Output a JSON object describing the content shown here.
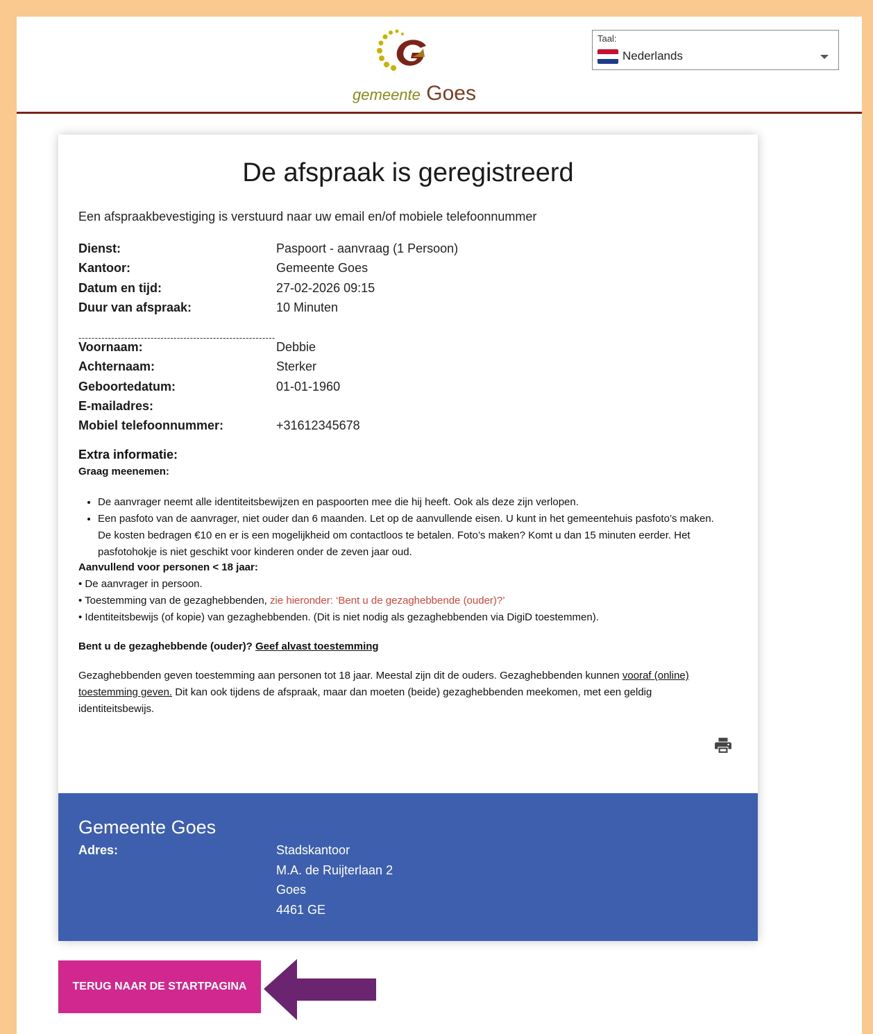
{
  "header": {
    "logo_small": "gemeente",
    "logo_big": "Goes",
    "language": {
      "label": "Taal:",
      "value": "Nederlands"
    }
  },
  "confirmation": {
    "title": "De afspraak is geregistreerd",
    "intro": "Een afspraakbevestiging is verstuurd naar uw email en/of mobiele telefoonnummer",
    "appointment": [
      {
        "label": "Dienst:",
        "value": "Paspoort - aanvraag (1 Persoon)"
      },
      {
        "label": "Kantoor:",
        "value": "Gemeente Goes"
      },
      {
        "label": "Datum en tijd:",
        "value": "27-02-2026 09:15"
      },
      {
        "label": "Duur van afspraak:",
        "value": "10 Minuten"
      }
    ],
    "separator": "------------------------------------------------------------",
    "person": [
      {
        "label": "Voornaam:",
        "value": "Debbie"
      },
      {
        "label": "Achternaam:",
        "value": "Sterker"
      },
      {
        "label": "Geboortedatum:",
        "value": "01-01-1960"
      },
      {
        "label": "E-mailadres:",
        "value": ""
      },
      {
        "label": "Mobiel telefoonnummer:",
        "value": "+31612345678"
      }
    ]
  },
  "extra": {
    "heading": "Extra informatie:",
    "bring_heading": "Graag meenemen:",
    "bullets": [
      "De aanvrager neemt alle identiteitsbewijzen en paspoorten mee die hij heeft. Ook als deze zijn verlopen.",
      "Een pasfoto van de aanvrager, niet ouder dan 6 maanden. Let op de aanvullende eisen. U kunt in het gemeentehuis pasfoto’s maken. De kosten bedragen €10 en er is een mogelijkheid om contactloos te betalen. Foto’s maken? Komt u dan 15 minuten eerder. Het pasfotohokje is niet geschikt voor kinderen onder de zeven jaar oud."
    ],
    "minor_heading": "Aanvullend voor personen < 18 jaar:",
    "minor_1": "• De aanvrager in persoon.",
    "minor_2_prefix": "• Toestemming van de gezaghebbenden, ",
    "minor_2_link": "zie hieronder: ‘Bent u de gezaghebbende (ouder)?’",
    "minor_3": "• Identiteitsbewijs (of kopie) van gezaghebbenden. (Dit is niet nodig als gezaghebbenden via DigiD toestemmen).",
    "guardian_question": "Bent u de gezaghebbende (ouder)?",
    "guardian_link": "Geef alvast toestemming",
    "para_1": "Gezaghebbenden geven toestemming aan personen tot 18 jaar. Meestal zijn dit de ouders. Gezaghebbenden kunnen ",
    "para_link": "vooraf (online) toestemming geven.",
    "para_2": " Dit kan ook tijdens de afspraak, maar dan moeten (beide) gezaghebbenden meekomen, met een geldig identiteitsbewijs."
  },
  "footer": {
    "name": "Gemeente Goes",
    "address_label": "Adres:",
    "address_lines": [
      "Stadskantoor",
      "M.A. de Ruijterlaan 2",
      "Goes",
      "4461 GE"
    ]
  },
  "actions": {
    "back_label": "TERUG NAAR DE STARTPAGINA"
  },
  "icons": {
    "print": "print-icon",
    "flag": "netherlands-flag-icon",
    "arrow": "arrow-left-icon"
  },
  "colors": {
    "page_border": "#f9c98f",
    "header_rule": "#7a2418",
    "footer_bg": "#3e5fad",
    "button_bg": "#d0288e",
    "arrow": "#6b2570",
    "link_red": "#d9463a"
  }
}
